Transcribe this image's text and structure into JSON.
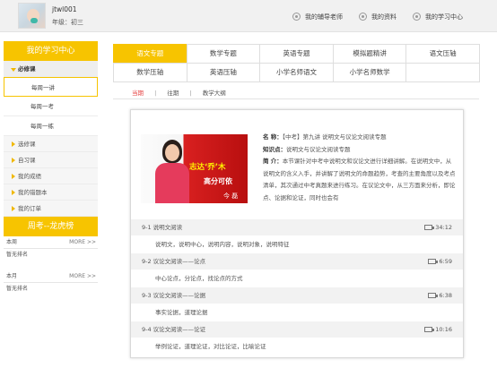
{
  "header": {
    "username": "jtwl001",
    "grade": "年级：初三",
    "links": [
      "我的辅导老师",
      "我的资料",
      "我的学习中心"
    ]
  },
  "sidebar": {
    "title": "我的学习中心",
    "section": "必修课",
    "sub_items": [
      "每周一讲",
      "每周一考",
      "每周一练"
    ],
    "items": [
      "选修课",
      "自习课",
      "我的成绩",
      "我的错题本",
      "我的订单"
    ]
  },
  "ranking": {
    "title": "周考--龙虎榜",
    "groups": [
      {
        "label": "本周",
        "more": "MORE >>",
        "empty": "暂无排名"
      },
      {
        "label": "本月",
        "more": "MORE >>",
        "empty": "暂无排名"
      }
    ]
  },
  "tabs": {
    "row1": [
      "语文专题",
      "数学专题",
      "英语专题",
      "模拟题精讲",
      "语文压轴"
    ],
    "row2": [
      "数学压轴",
      "英语压轴",
      "小学名师语文",
      "小学名师数学",
      ""
    ],
    "active": "语文专题"
  },
  "filters": {
    "current": "当期",
    "past": "往期",
    "outline": "教学大纲",
    "separator": "|"
  },
  "course": {
    "banner": {
      "slogan_line1": "志达‘乔’木",
      "slogan_line2": "高分可依",
      "signature": "今 磊"
    },
    "name_label": "名    称：",
    "name": "【中考】第九讲 说明文与议论文阅读专题",
    "knowledge_label": "知识点：",
    "knowledge": "说明文与议论文阅读专题",
    "intro_label": "简    介：",
    "intro": "本节课针对中考中说明文和议论文进行详细讲解。在说明文中，从说明文的含义入手，并讲解了说明文的命题趋势，考查的主要角度以及考点清单，其次通过中考真题来进行练习。在议论文中，从三方面来分析，即论点、论据和论证，同时也会有",
    "lessons": [
      {
        "title": "9-1 说明文阅读",
        "duration": "34:12",
        "desc": "说明文，说明中心，说明内容，说明对象，说明特征"
      },
      {
        "title": "9-2 议论文阅读——论点",
        "duration": "6:59",
        "desc": "中心论点，分论点，找论点的方式"
      },
      {
        "title": "9-3 议论文阅读——论据",
        "duration": "6:38",
        "desc": "事实论据，道理论据"
      },
      {
        "title": "9-4 议论文阅读——论证",
        "duration": "10:16",
        "desc": "举例论证，道理论证，对比论证，比喻论证"
      }
    ]
  },
  "colors": {
    "accent": "#f7c400",
    "banner_red": "#c81a1a",
    "current_filter": "#e53f3f"
  }
}
